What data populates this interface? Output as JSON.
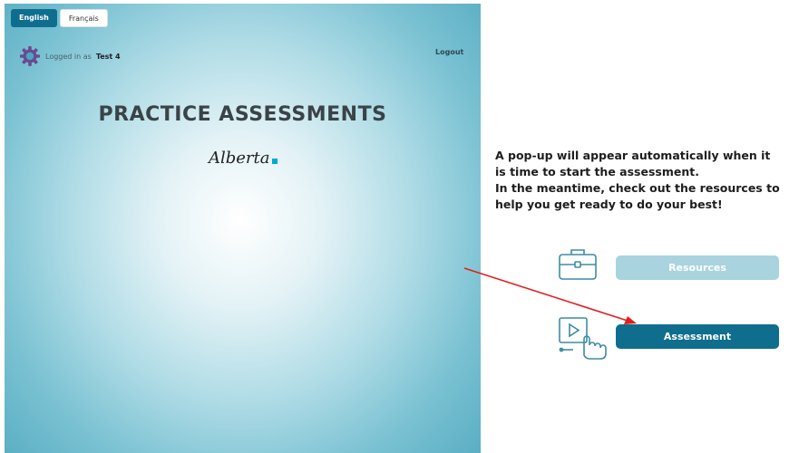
{
  "language": {
    "english_label": "English",
    "french_label": "Français"
  },
  "user": {
    "logged_prefix": "Logged in as",
    "username": "Test 4"
  },
  "header": {
    "logout_label": "Logout"
  },
  "main": {
    "title": "PRACTICE ASSESSMENTS",
    "brand": "Alberta"
  },
  "panel": {
    "message_line1": "A pop-up will appear automatically when it is time to start the assessment.",
    "message_line2": "In the meantime, check out the resources to help you get ready to do your best!",
    "resources_label": "Resources",
    "assessment_label": "Assessment"
  },
  "colors": {
    "primary": "#0f6e8e",
    "disabled": "#a9d4df",
    "annotation_arrow": "#e02020"
  },
  "icons": {
    "gear": "gear-icon",
    "briefcase": "briefcase-icon",
    "video_touch": "video-touch-icon"
  }
}
